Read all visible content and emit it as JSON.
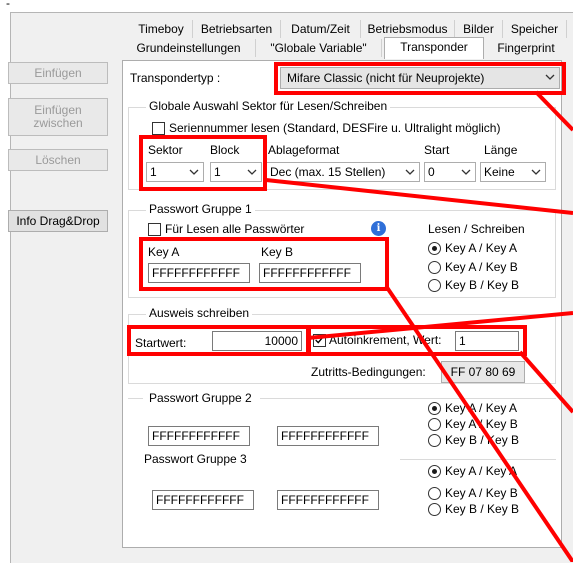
{
  "corner_mark": "-",
  "sidebar": {
    "buttons": [
      {
        "label": "Einfügen"
      },
      {
        "label": "Einfügen\nzwischen"
      },
      {
        "label": "Löschen"
      },
      {
        "label": "Info Drag&Drop"
      }
    ]
  },
  "tabs_row1": [
    "Timeboy",
    "Betriebsarten",
    "Datum/Zeit",
    "Betriebsmodus",
    "Bilder",
    "Speicher"
  ],
  "tabs_row2": [
    "Grundeinstellungen",
    "\"Globale Variable\"",
    "Transponder",
    "Fingerprint"
  ],
  "transponder": {
    "type_label": "Transpondertyp :",
    "type_value": "Mifare Classic (nicht für Neuprojekte)",
    "global_group_title": "Globale Auswahl Sektor für Lesen/Schreiben",
    "serial_checkbox_label": "Seriennummer lesen (Standard, DESFire u. Ultralight möglich)",
    "sector_label": "Sektor",
    "block_label": "Block",
    "format_label": "Ablageformat",
    "start_label": "Start",
    "length_label": "Länge",
    "sector_value": "1",
    "block_value": "1",
    "format_value": "Dec (max. 15 Stellen)",
    "start_value": "0",
    "length_value": "Keine",
    "pw1_title": "Passwort Gruppe 1",
    "pw1_checkbox_label": "Für Lesen alle Passwörter",
    "info_icon_text": "i",
    "rw_label": "Lesen / Schreiben",
    "key_a_label": "Key A",
    "key_b_label": "Key B",
    "key_a_value": "FFFFFFFFFFFF",
    "key_b_value": "FFFFFFFFFFFF",
    "radio_options": [
      "Key A / Key A",
      "Key A / Key B",
      "Key B / Key B"
    ],
    "write_title": "Ausweis schreiben",
    "start_value_label": "Startwert:",
    "start_value_value": "10000",
    "autoinc_label": "Autoinkrement, Wert:",
    "autoinc_value": "1",
    "access_label": "Zutritts-Bedingungen:",
    "access_value": "FF 07 80 69",
    "pw2_title": "Passwort Gruppe 2",
    "pw2_key_a": "FFFFFFFFFFFF",
    "pw2_key_b": "FFFFFFFFFFFF",
    "pw3_title": "Passwort Gruppe 3",
    "pw3_key_a": "FFFFFFFFFFFF",
    "pw3_key_b": "FFFFFFFFFFFF"
  },
  "colors": {
    "highlight": "#ff0000",
    "window_bg": "#f0f0f0"
  }
}
